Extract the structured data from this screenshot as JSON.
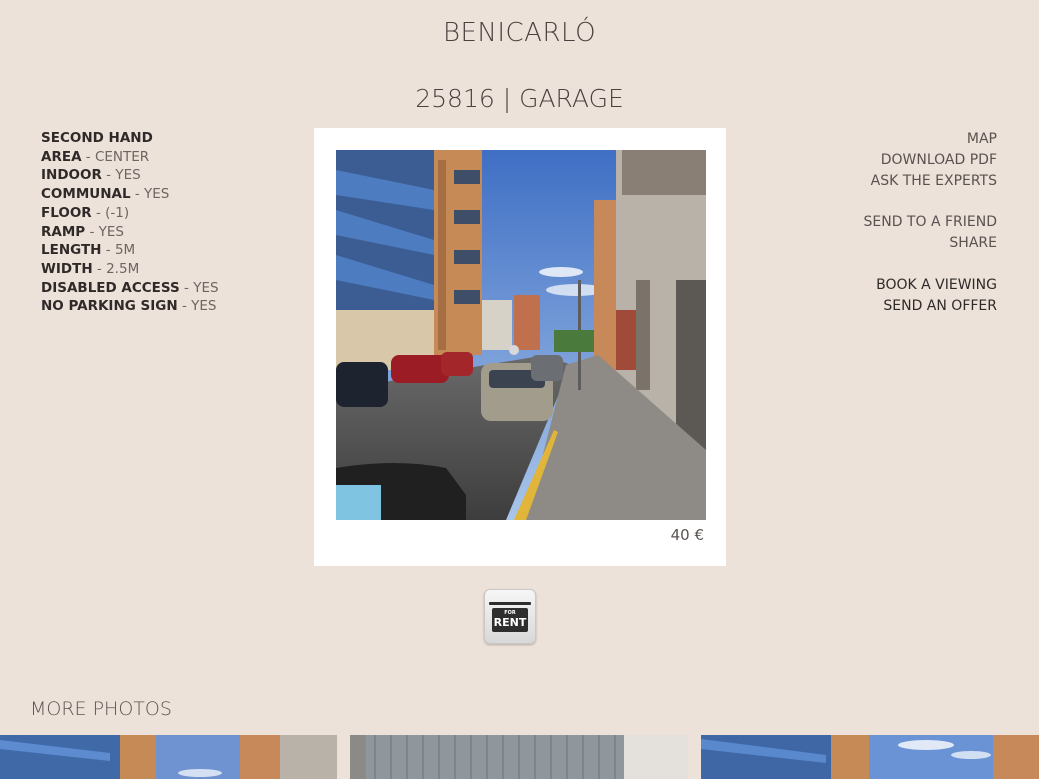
{
  "header": {
    "town": "BENICARLÓ",
    "reference": "25816 | GARAGE"
  },
  "features": [
    {
      "key": "SECOND HAND",
      "value": ""
    },
    {
      "key": "AREA",
      "value": " - CENTER"
    },
    {
      "key": "INDOOR",
      "value": " - YES"
    },
    {
      "key": "COMMUNAL",
      "value": " - YES"
    },
    {
      "key": "FLOOR",
      "value": " - (-1)"
    },
    {
      "key": "RAMP",
      "value": " - YES"
    },
    {
      "key": "LENGTH",
      "value": " - 5M"
    },
    {
      "key": "WIDTH",
      "value": " - 2.5M"
    },
    {
      "key": "DISABLED ACCESS",
      "value": " - YES"
    },
    {
      "key": "NO PARKING SIGN",
      "value": " - YES"
    }
  ],
  "actions": {
    "map": "MAP",
    "download_pdf": "DOWNLOAD PDF",
    "ask_experts": "ASK THE EXPERTS",
    "send_friend": "SEND TO A FRIEND",
    "share": "SHARE",
    "book_viewing": "BOOK A VIEWING",
    "send_offer": "SEND AN OFFER"
  },
  "listing": {
    "price": "40 €",
    "rent_badge_small": "FOR",
    "rent_badge_big": "RENT"
  },
  "more_photos": {
    "title": "MORE PHOTOS"
  },
  "colors": {
    "background": "#ede2d9",
    "card": "#ffffff",
    "text_dark": "#2f2a29",
    "text_muted": "#6d6563"
  }
}
